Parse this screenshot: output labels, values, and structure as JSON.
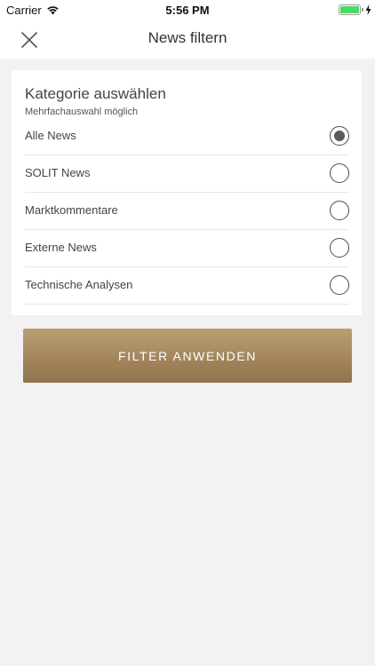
{
  "status_bar": {
    "carrier": "Carrier",
    "time": "5:56 PM",
    "wifi_icon": "wifi-icon",
    "battery_icon": "battery-icon",
    "battery_level": 1.0,
    "charging_icon": "bolt-icon"
  },
  "navbar": {
    "title": "News filtern",
    "close_icon": "close-icon"
  },
  "filter": {
    "title": "Kategorie auswählen",
    "subtitle": "Mehrfachauswahl möglich",
    "options": [
      {
        "label": "Alle News",
        "selected": true
      },
      {
        "label": "SOLIT News",
        "selected": false
      },
      {
        "label": "Marktkommentare",
        "selected": false
      },
      {
        "label": "Externe News",
        "selected": false
      },
      {
        "label": "Technische Analysen",
        "selected": false
      }
    ]
  },
  "apply_button": {
    "label": "FILTER ANWENDEN"
  },
  "colors": {
    "background": "#f2f2f2",
    "card": "#ffffff",
    "button_gold": "#a3865c",
    "battery_green": "#4cd964"
  }
}
